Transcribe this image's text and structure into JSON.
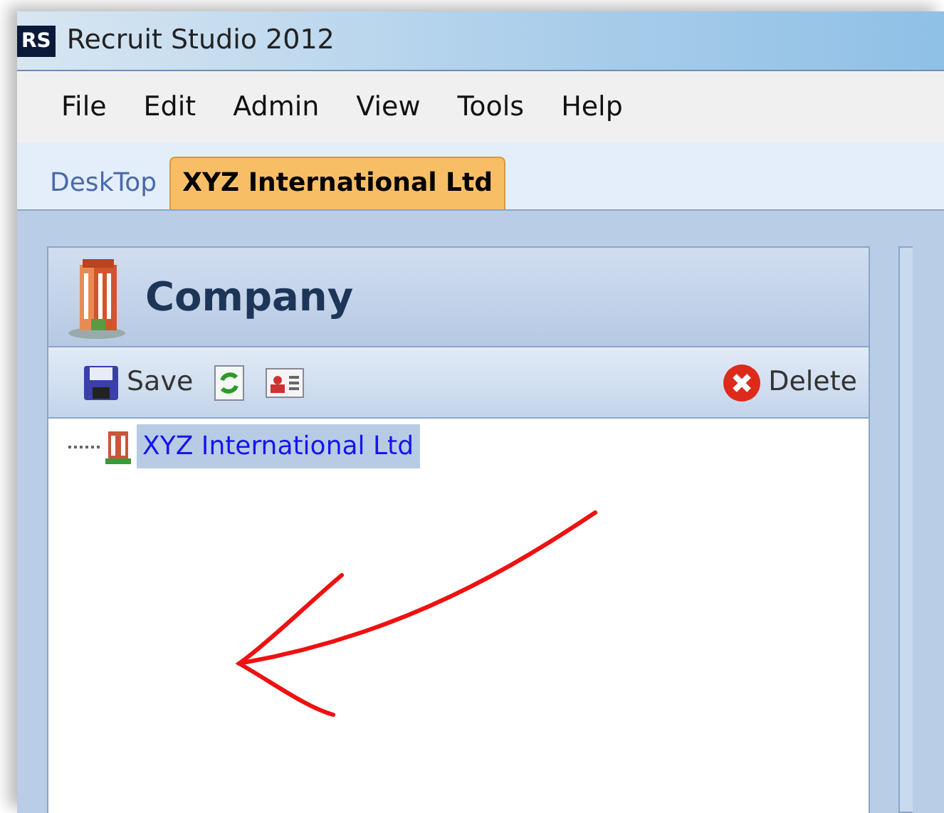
{
  "window": {
    "title": "Recruit Studio 2012",
    "app_badge": "RS"
  },
  "menu": [
    "File",
    "Edit",
    "Admin",
    "View",
    "Tools",
    "Help"
  ],
  "tabs": [
    {
      "label": "DeskTop",
      "selected": false
    },
    {
      "label": "XYZ International Ltd",
      "selected": true
    }
  ],
  "panel": {
    "title": "Company"
  },
  "toolbar": [
    {
      "kind": "save",
      "label": "Save"
    },
    {
      "kind": "refresh"
    },
    {
      "kind": "card"
    },
    {
      "kind": "delete",
      "label": "Delete"
    }
  ],
  "tree": [
    {
      "label": "XYZ International Ltd",
      "selected": true
    }
  ]
}
